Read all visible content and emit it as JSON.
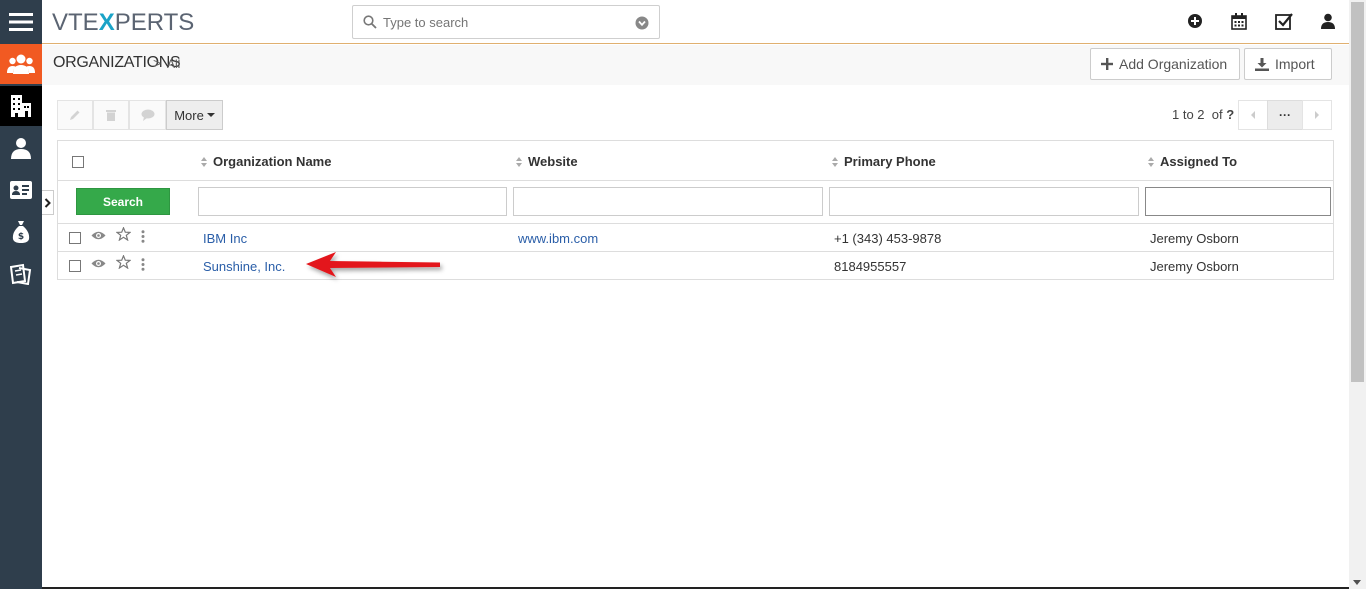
{
  "brand": {
    "logo_left": "VTE",
    "logo_x": "X",
    "logo_right": "PERTS",
    "accent": "#1aa3c7"
  },
  "sidebar": {
    "items": [
      {
        "icon": "hamburger-menu-icon"
      },
      {
        "icon": "users-icon",
        "active_color": "#f15a22"
      },
      {
        "icon": "building-icon",
        "selected": true
      },
      {
        "icon": "person-icon"
      },
      {
        "icon": "contact-card-icon"
      },
      {
        "icon": "money-bag-icon"
      },
      {
        "icon": "tickets-icon"
      }
    ]
  },
  "header": {
    "search_placeholder": "Type to search",
    "actions": [
      "add-circle-icon",
      "calendar-icon",
      "tasks-icon",
      "user-profile-icon"
    ]
  },
  "breadcrumb": {
    "module": "ORGANIZATIONS",
    "separator": ">",
    "filter": "All"
  },
  "page_actions": {
    "add_label": "Add Organization",
    "import_label": "Import"
  },
  "toolbar": {
    "more_label": "More",
    "pager_range": "1 to 2",
    "pager_of": "of",
    "pager_total": "?",
    "pager_more": "···"
  },
  "table": {
    "columns": [
      "Organization Name",
      "Website",
      "Primary Phone",
      "Assigned To"
    ],
    "search_label": "Search",
    "rows": [
      {
        "name": "IBM Inc",
        "website": "www.ibm.com",
        "phone": "+1 (343) 453-9878",
        "assigned": "Jeremy Osborn"
      },
      {
        "name": "Sunshine, Inc.",
        "website": "",
        "phone": "8184955557",
        "assigned": "Jeremy Osborn"
      }
    ]
  },
  "colors": {
    "sidebar_bg": "#2f3e4c",
    "search_button": "#35a94a",
    "link": "#2a5ea8",
    "annotation_arrow": "#e3191b"
  }
}
